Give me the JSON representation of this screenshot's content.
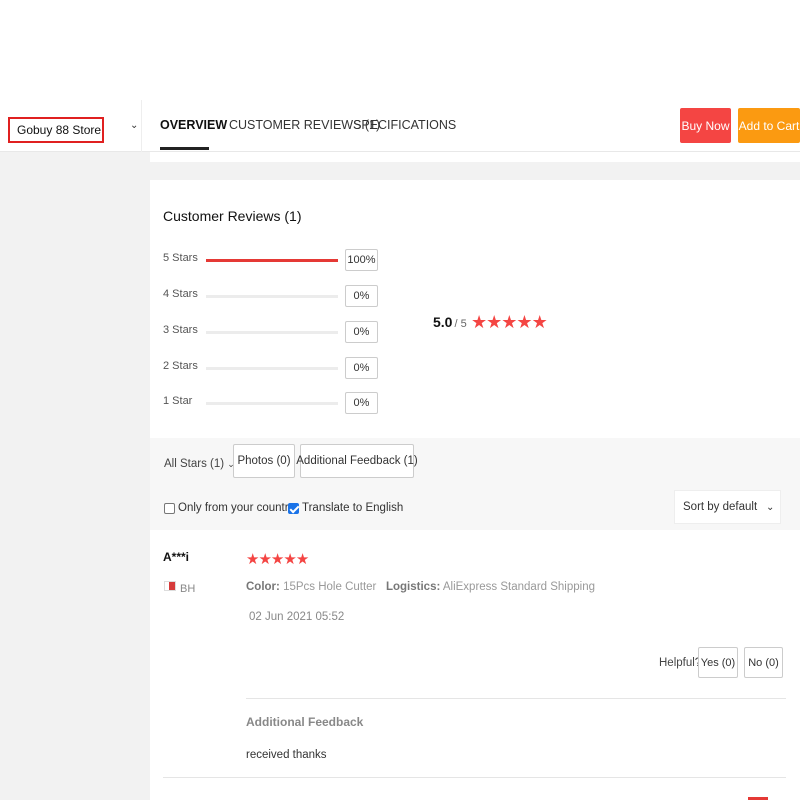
{
  "header": {
    "store_name": "Gobuy 88 Store",
    "tabs": [
      {
        "label": "OVERVIEW",
        "active": true
      },
      {
        "label": "CUSTOMER REVIEWS (1)",
        "active": false
      },
      {
        "label": "SPECIFICATIONS",
        "active": false
      }
    ],
    "buy_now": "Buy Now",
    "add_to_cart": "Add to Cart"
  },
  "reviews": {
    "title": "Customer Reviews (1)",
    "distribution": [
      {
        "label": "5 Stars",
        "percent": 100,
        "pct_text": "100%"
      },
      {
        "label": "4 Stars",
        "percent": 0,
        "pct_text": "0%"
      },
      {
        "label": "3 Stars",
        "percent": 0,
        "pct_text": "0%"
      },
      {
        "label": "2 Stars",
        "percent": 0,
        "pct_text": "0%"
      },
      {
        "label": "1 Star",
        "percent": 0,
        "pct_text": "0%"
      }
    ],
    "average": "5.0",
    "out_of": "/ 5",
    "average_stars": 5
  },
  "filters": {
    "all_stars": "All Stars (1)",
    "photos": "Photos (0)",
    "additional_feedback": "Additional Feedback (1)",
    "only_country": "Only from your country",
    "only_country_checked": false,
    "translate": "Translate to English",
    "translate_checked": true,
    "sort": "Sort by default"
  },
  "review": {
    "reviewer": "A***i",
    "country": "BH",
    "stars": 5,
    "color_label": "Color:",
    "color_value": "15Pcs Hole Cutter",
    "logistics_label": "Logistics:",
    "logistics_value": "AliExpress Standard Shipping",
    "date": "02 Jun 2021 05:52",
    "helpful": "Helpful?",
    "yes": "Yes (0)",
    "no": "No (0)",
    "additional_feedback_title": "Additional Feedback",
    "additional_feedback_text": "received thanks"
  },
  "colors": {
    "accent_red": "#f44543",
    "accent_orange": "#fb9a11"
  },
  "icons": {
    "star": "star-icon",
    "chevron": "chevron-down-icon",
    "flag": "flag-icon"
  }
}
